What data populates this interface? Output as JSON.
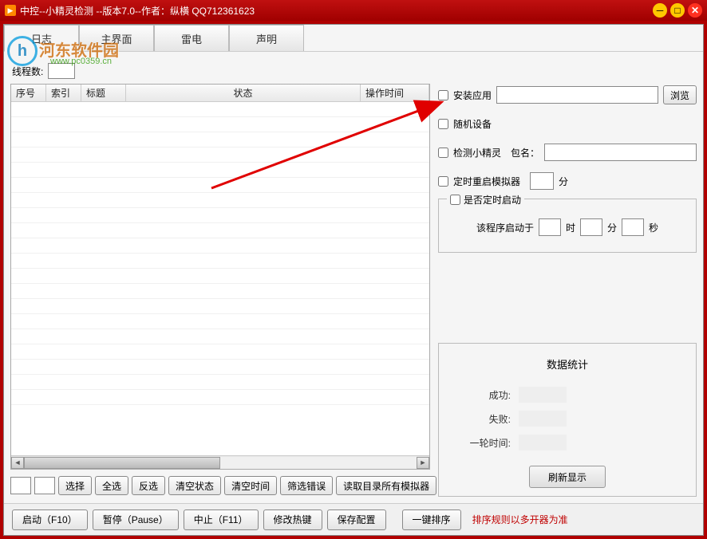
{
  "titlebar": {
    "text": "中控--小精灵检测 --版本7.0--作者：纵横 QQ712361623"
  },
  "tabs": [
    "日志",
    "主界面",
    "雷电",
    "声明"
  ],
  "watermark": {
    "logo_letter": "h",
    "name": "河东软件园",
    "url": "www.pc0359.cn"
  },
  "left": {
    "thread_label": "线程数:",
    "thread_value": "",
    "columns": {
      "seq": "序号",
      "idx": "索引",
      "title": "标题",
      "status": "状态",
      "time": "操作时间"
    },
    "buttons": {
      "select": "选择",
      "all": "全选",
      "invert": "反选",
      "clear_status": "清空状态",
      "clear_time": "清空时间",
      "filter_err": "筛选错误",
      "read_emu": "读取目录所有模拟器"
    }
  },
  "right": {
    "install_app": "安装应用",
    "browse": "浏览",
    "install_path": "",
    "rand_device": "随机设备",
    "detect_sprite": "检测小精灵",
    "pkg_label": "包名：",
    "pkg_value": "",
    "timed_restart": "定时重启模拟器",
    "restart_value": "",
    "min_unit": "分",
    "timed_start": "是否定时启动",
    "start_prefix": "该程序启动于",
    "hour": "时",
    "min": "分",
    "sec": "秒",
    "h_v": "",
    "m_v": "",
    "s_v": "",
    "stats_title": "数据统计",
    "stats": {
      "success": "成功:",
      "fail": "失败:",
      "round": "一轮时间:"
    },
    "refresh": "刷新显示"
  },
  "footer": {
    "start": "启动（F10）",
    "pause": "暂停（Pause）",
    "stop": "中止（F11）",
    "hotkey": "修改热键",
    "save": "保存配置",
    "sort": "一键排序",
    "note": "排序规则以多开器为准"
  }
}
